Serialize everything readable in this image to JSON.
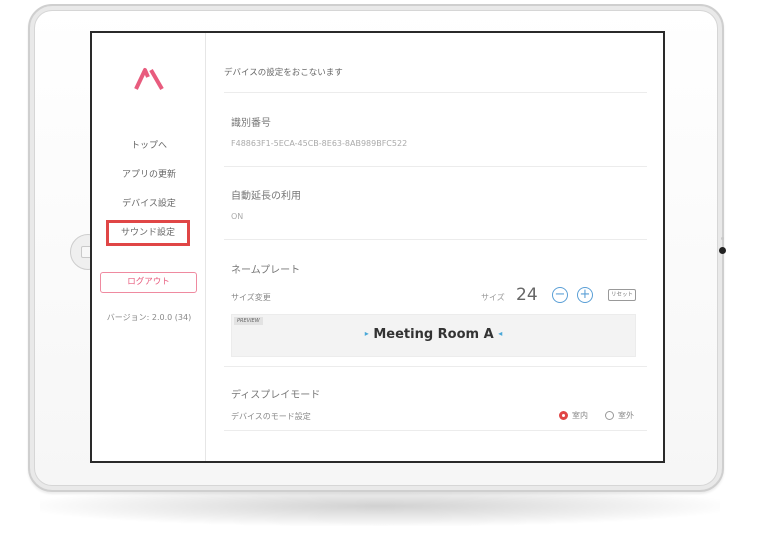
{
  "sidebar": {
    "logo": "logo-icon",
    "items": [
      {
        "label": "トップへ"
      },
      {
        "label": "アプリの更新"
      },
      {
        "label": "デバイス設定"
      },
      {
        "label": "サウンド設定"
      }
    ],
    "logout_label": "ログアウト",
    "version": "バージョン: 2.0.0 (34)"
  },
  "main": {
    "header": "デバイスの設定をおこないます",
    "device_id": {
      "title": "識別番号",
      "value": "F48863F1-5ECA-45CB-8E63-8AB989BFC522"
    },
    "auto_extend": {
      "title": "自動延長の利用",
      "value": "ON"
    },
    "nameplate": {
      "title": "ネームプレート",
      "size_change_label": "サイズ変更",
      "size_label": "サイズ",
      "size_value": "24",
      "minus": "−",
      "plus": "+",
      "reset_label": "リセット",
      "preview_tag": "PREVIEW",
      "preview_text": "Meeting Room A",
      "arrow_left": "▸",
      "arrow_right": "◂"
    },
    "display_mode": {
      "title": "ディスプレイモード",
      "sub_label": "デバイスのモード設定",
      "options": [
        {
          "label": "室内",
          "selected": true
        },
        {
          "label": "室外",
          "selected": false
        }
      ]
    }
  },
  "colors": {
    "accent": "#e04646",
    "brand": "#e85c7e",
    "button_blue": "#5a9fd6"
  }
}
